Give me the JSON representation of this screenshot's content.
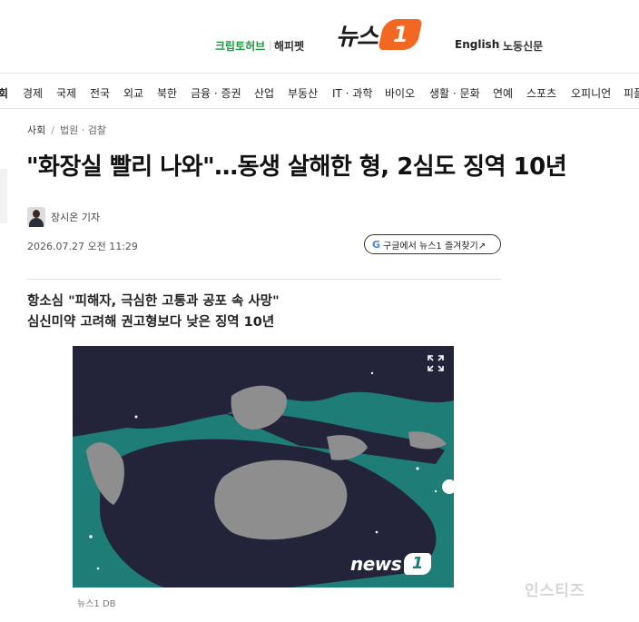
{
  "header": {
    "links_left": [
      "크립토허브",
      "해피펫"
    ],
    "links_right": [
      "English",
      "노동신문"
    ],
    "logo_text": "뉴스",
    "logo_badge": "1"
  },
  "nav": {
    "items": [
      "회",
      "경제",
      "국제",
      "전국",
      "외교",
      "북한",
      "금융 · 증권",
      "산업",
      "부동산",
      "IT · 과학",
      "바이오",
      "생활 · 문화",
      "연예",
      "스포츠",
      "오피니언",
      "피플"
    ]
  },
  "article": {
    "breadcrumb": [
      "사회",
      "법원 · 검찰"
    ],
    "headline": "\"화장실 빨리 나와\"…동생 살해한 형, 2심도 징역 10년",
    "reporter": "장시온 기자",
    "datetime": "2026.07.27 오전 11:29",
    "google_button": "구글에서 뉴스1 즐겨찾기↗",
    "google_icon": "G",
    "subheadlines": [
      "항소심 \"피해자, 극심한 고통과 공포 속 사망\"",
      "심신미약 고려해 권고형보다 낮은 징역 10년"
    ],
    "image_logo": "news",
    "caption": "뉴스1 DB"
  },
  "watermark": "인스티즈",
  "colors": {
    "brand_orange": "#f26722",
    "cryptohub_green": "#1a9c3e",
    "illustration_teal": "#1f7d78",
    "illustration_dark": "#23243a"
  },
  "icons": [
    "expand-icon",
    "google-icon",
    "reporter-avatar"
  ]
}
